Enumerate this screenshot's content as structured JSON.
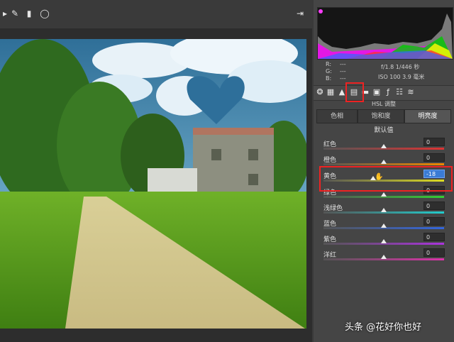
{
  "window": {
    "toolbar_icons": [
      "crop-icon",
      "brush-icon",
      "gradient-icon",
      "ellipse-icon",
      "export-icon"
    ]
  },
  "histogram": {
    "colors": [
      "#ff00ff",
      "#00cc00",
      "#ffff00",
      "#ff0000",
      "#3366ff",
      "#00ffff"
    ]
  },
  "info": {
    "r_label": "R:",
    "g_label": "G:",
    "b_label": "B:",
    "r_val": "---",
    "g_val": "---",
    "b_val": "---",
    "line1": "f/1.8   1/446 秒",
    "line2": "ISO 100  3.9 毫米"
  },
  "panel": {
    "title": "HSL 调整"
  },
  "tabs": [
    {
      "label": "色相"
    },
    {
      "label": "饱和度"
    },
    {
      "label": "明亮度",
      "active": true
    }
  ],
  "default_link": "默认值",
  "sliders": [
    {
      "label": "红色",
      "value": "0",
      "level": 0,
      "color": "#d33"
    },
    {
      "label": "橙色",
      "value": "0",
      "level": 0,
      "color": "#e80"
    },
    {
      "label": "黄色",
      "value": "-18",
      "level": -18,
      "color": "#dd2",
      "selected": true
    },
    {
      "label": "绿色",
      "value": "0",
      "level": 0,
      "color": "#3c3"
    },
    {
      "label": "浅绿色",
      "value": "0",
      "level": 0,
      "color": "#2cc"
    },
    {
      "label": "蓝色",
      "value": "0",
      "level": 0,
      "color": "#36d"
    },
    {
      "label": "紫色",
      "value": "0",
      "level": 0,
      "color": "#a3d"
    },
    {
      "label": "洋红",
      "value": "0",
      "level": 0,
      "color": "#d3a"
    }
  ],
  "watermark": "头条 @花好你也好"
}
